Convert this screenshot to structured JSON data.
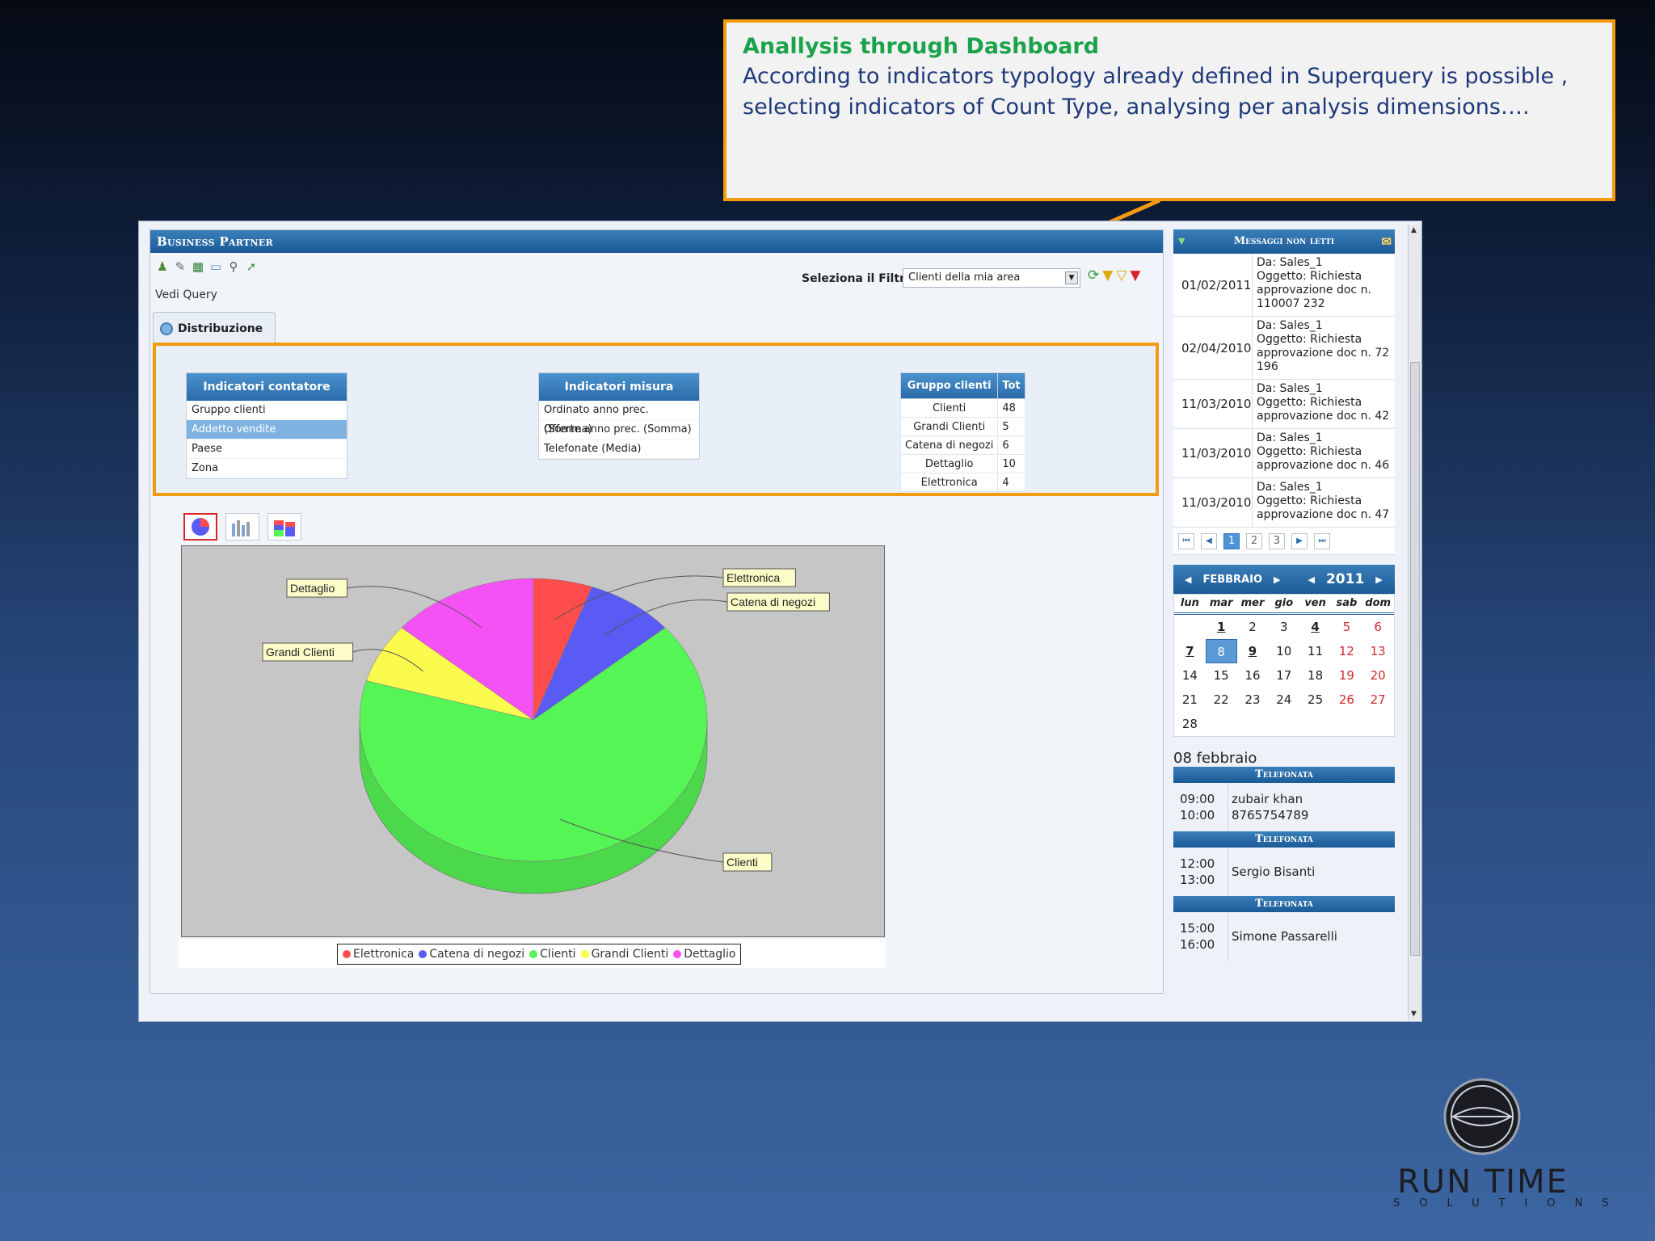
{
  "callout": {
    "title": "Anallysis through Dashboard",
    "text_line1": "According to  indicators typology already defined in Superquery is possible ,",
    "text_line2": "selecting indicators of  Count Type, analysing  per analysis dimensions…."
  },
  "app": {
    "panel_title": "Business Partner",
    "toolbar_label": "Vedi Query",
    "filter_label": "Seleziona il Filtro",
    "filter_value": "Clienti della mia area",
    "tab_label": "Distribuzione"
  },
  "indicatori_contatore": {
    "header": "Indicatori contatore",
    "items": [
      "Gruppo clienti",
      "Addetto vendite",
      "Paese",
      "Zona"
    ],
    "selected": "Addetto vendite"
  },
  "indicatori_misura": {
    "header": "Indicatori misura",
    "items": [
      "Ordinato anno prec. (Somma)",
      "Offerte anno prec. (Somma)",
      "Telefonate (Media)"
    ]
  },
  "gruppo_clienti": {
    "headers": [
      "Gruppo clienti",
      "Tot"
    ],
    "rows": [
      {
        "name": "Clienti",
        "tot": "48"
      },
      {
        "name": "Grandi Clienti",
        "tot": "5"
      },
      {
        "name": "Catena di negozi",
        "tot": "6"
      },
      {
        "name": "Dettaglio",
        "tot": "10"
      },
      {
        "name": "Elettronica",
        "tot": "4"
      }
    ]
  },
  "chart_data": {
    "type": "pie",
    "categories": [
      "Elettronica",
      "Catena di negozi",
      "Clienti",
      "Grandi Clienti",
      "Dettaglio"
    ],
    "values": [
      4,
      6,
      48,
      5,
      10
    ],
    "colors": [
      "#ff4d4d",
      "#5a5af5",
      "#55f555",
      "#fbfb4e",
      "#f552f5"
    ],
    "legend_position": "bottom",
    "title": ""
  },
  "messages": {
    "title": "Messaggi non letti",
    "items": [
      {
        "date": "01/02/2011",
        "from": "Da: Sales_1",
        "subject": "Oggetto: Richiesta approvazione doc n. 110007 232"
      },
      {
        "date": "02/04/2010",
        "from": "Da: Sales_1",
        "subject": "Oggetto: Richiesta approvazione doc n. 72 196"
      },
      {
        "date": "11/03/2010",
        "from": "Da: Sales_1",
        "subject": "Oggetto: Richiesta approvazione doc n. 42"
      },
      {
        "date": "11/03/2010",
        "from": "Da: Sales_1",
        "subject": "Oggetto: Richiesta approvazione doc n. 46"
      },
      {
        "date": "11/03/2010",
        "from": "Da: Sales_1",
        "subject": "Oggetto: Richiesta approvazione doc n. 47"
      }
    ],
    "pages": [
      "1",
      "2",
      "3"
    ],
    "current_page": "1"
  },
  "calendar": {
    "month": "FEBBRAIO",
    "year": "2011",
    "days_of_week": [
      "lun",
      "mar",
      "mer",
      "gio",
      "ven",
      "sab",
      "dom"
    ],
    "weeks": [
      [
        "",
        "1",
        "2",
        "3",
        "4",
        "5",
        "6"
      ],
      [
        "7",
        "8",
        "9",
        "10",
        "11",
        "12",
        "13"
      ],
      [
        "14",
        "15",
        "16",
        "17",
        "18",
        "19",
        "20"
      ],
      [
        "21",
        "22",
        "23",
        "24",
        "25",
        "26",
        "27"
      ],
      [
        "28",
        "",
        "",
        "",
        "",
        "",
        ""
      ]
    ],
    "today": "8",
    "marked_days": [
      "1",
      "4",
      "7",
      "9"
    ]
  },
  "agenda": {
    "date_label": "08 febbraio",
    "events": [
      {
        "type": "Telefonata",
        "start": "09:00",
        "end": "10:00",
        "name": "zubair khan",
        "detail": "8765754789"
      },
      {
        "type": "Telefonata",
        "start": "12:00",
        "end": "13:00",
        "name": "Sergio Bisanti",
        "detail": ""
      },
      {
        "type": "Telefonata",
        "start": "15:00",
        "end": "16:00",
        "name": "Simone Passarelli",
        "detail": ""
      }
    ]
  },
  "logo": {
    "name": "RUN TIME",
    "sub": "SOLUTIONS"
  }
}
